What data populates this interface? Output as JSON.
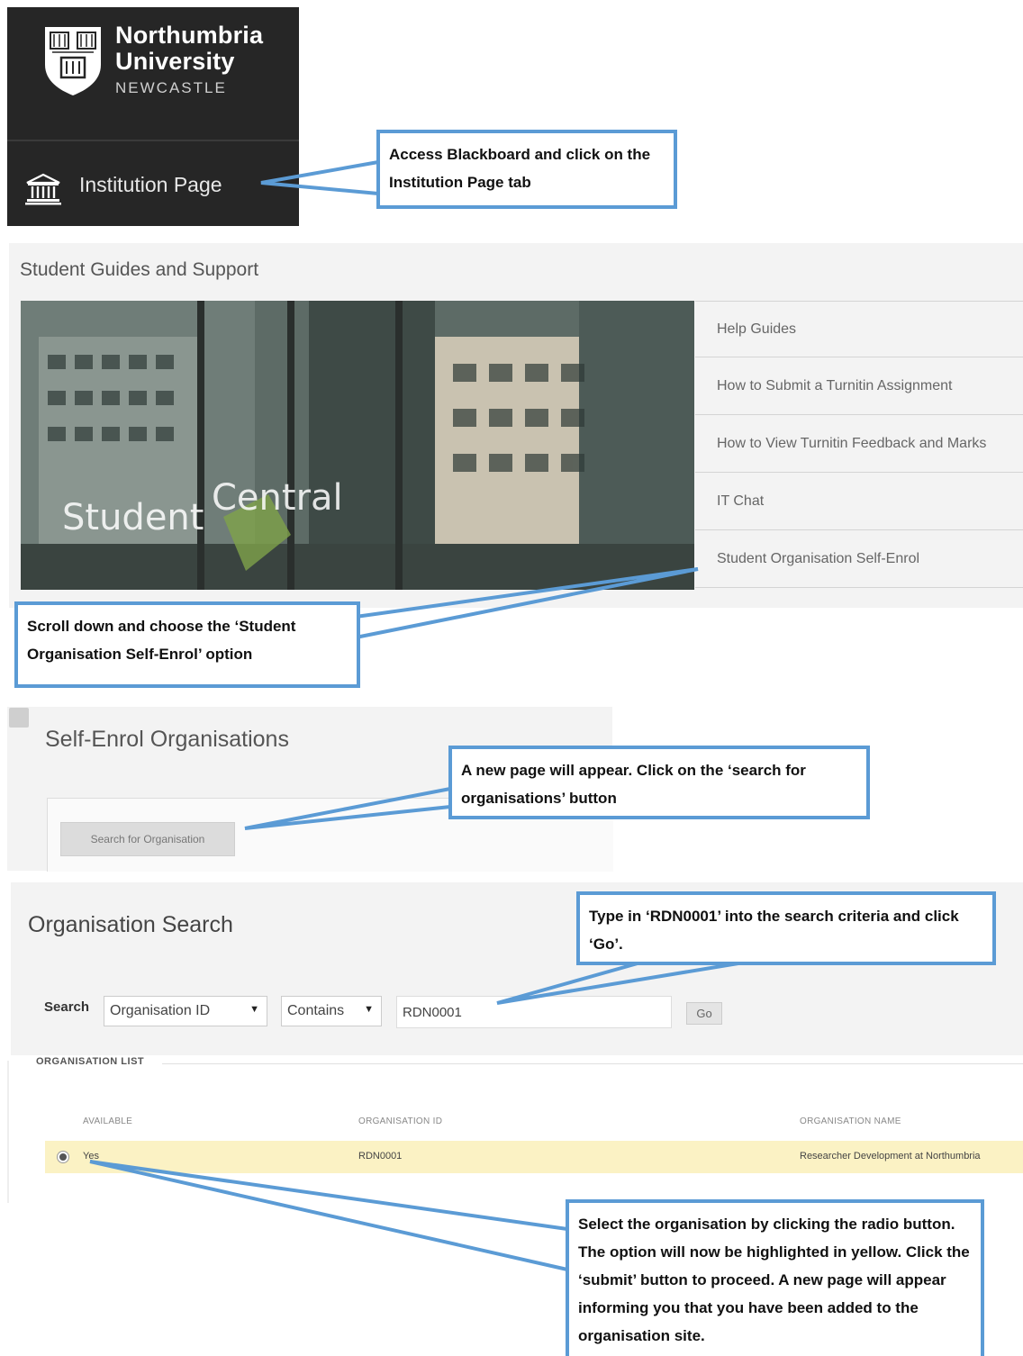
{
  "nu_header": {
    "name_line1": "Northumbria",
    "name_line2": "University",
    "city": "NEWCASTLE",
    "institution_tab": "Institution Page"
  },
  "guides": {
    "title": "Student Guides and Support",
    "image_words": [
      "Student",
      "Central"
    ],
    "links": [
      "Help Guides",
      "How to Submit a Turnitin Assignment",
      "How to View Turnitin Feedback and Marks",
      "IT Chat",
      "Student Organisation Self-Enrol"
    ]
  },
  "self_enrol": {
    "title": "Self-Enrol Organisations",
    "button": "Search for Organisation"
  },
  "org_search": {
    "title": "Organisation Search",
    "search_label": "Search",
    "field_select": "Organisation ID",
    "operator_select": "Contains",
    "input_value": "RDN0001",
    "go_button": "Go"
  },
  "org_list": {
    "heading": "ORGANISATION LIST",
    "columns": [
      "AVAILABLE",
      "ORGANISATION ID",
      "ORGANISATION NAME"
    ],
    "row": {
      "available": "Yes",
      "id": "RDN0001",
      "name": "Researcher Development at Northumbria"
    }
  },
  "callouts": {
    "step1": "Access Blackboard and click on the Institution Page tab",
    "step2": "Scroll down and choose the ‘Student Organisation Self-Enrol’ option",
    "step3": "A new page will appear. Click on the ‘search for organisations’ button",
    "step4": "Type in ‘RDN0001’ into the search criteria and click ‘Go’.",
    "step5": "Select the organisation by clicking the radio button. The option will now be highlighted in yellow. Click the ‘submit’ button to proceed. A new page will appear informing you that you have been added to the organisation site."
  },
  "colors": {
    "callout_border": "#5b9bd5",
    "header_bg": "#262626",
    "selected_row": "#fbf2c4"
  }
}
